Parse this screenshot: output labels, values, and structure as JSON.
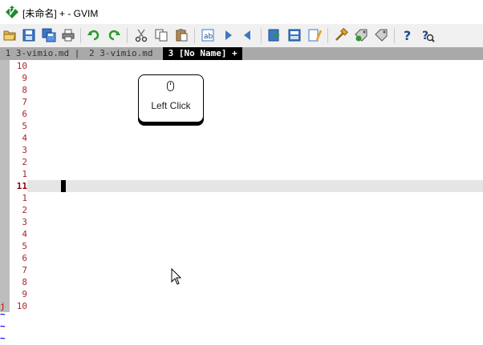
{
  "window": {
    "title": "[未命名] + - GVIM"
  },
  "icons": {
    "app": "vim-icon",
    "toolbar": [
      "open-folder-icon",
      "save-icon",
      "save-all-icon",
      "print-icon",
      "undo-icon",
      "redo-icon",
      "cut-icon",
      "copy-icon",
      "paste-icon",
      "find-replace-icon",
      "find-next-icon",
      "find-prev-icon",
      "load-session-icon",
      "save-session-icon",
      "run-script-icon",
      "make-icon",
      "build-tags-icon",
      "jump-to-tag-icon",
      "help-icon",
      "find-help-icon"
    ]
  },
  "tabs": [
    {
      "label": " 1 3-vimio.md | ",
      "selected": false
    },
    {
      "label": "2 3-vimio.md ",
      "selected": false
    },
    {
      "label": " 3 [No Name] + ",
      "selected": true
    }
  ],
  "editor": {
    "line_numbers_above": [
      "10",
      "9",
      "8",
      "7",
      "6",
      "5",
      "4",
      "3",
      "2",
      "1"
    ],
    "current_line_number": "11",
    "line_numbers_below": [
      "1",
      "2",
      "3",
      "4",
      "5",
      "6",
      "7",
      "8",
      "9",
      "10"
    ],
    "left_marker": "j",
    "tilde_char": "~",
    "tilde_count": 3
  },
  "overlay": {
    "label": "Left Click",
    "icon": "mouse-icon"
  },
  "colors": {
    "line_number": "#a52a2a",
    "cursorline": "#e5e5e5",
    "tilde": "#0000ee",
    "tab_selected": "#000000",
    "tab_bg": "#a9a9a9"
  }
}
